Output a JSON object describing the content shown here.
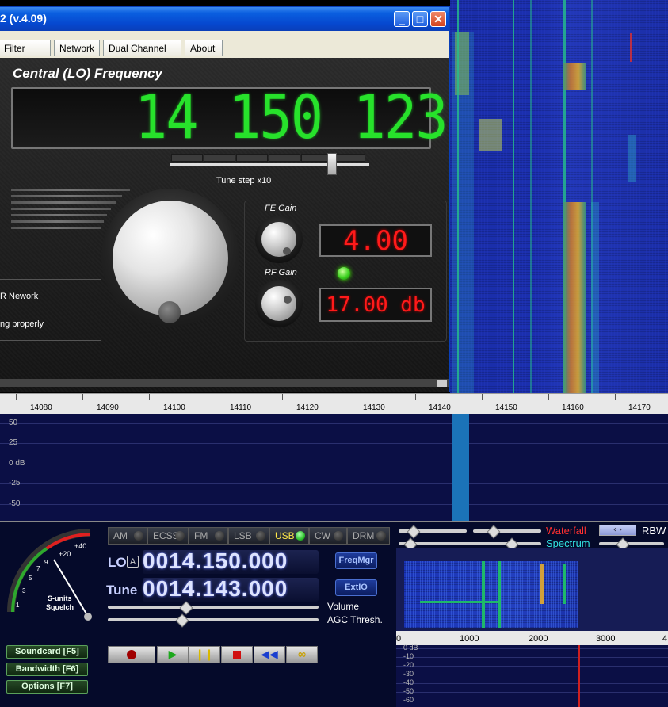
{
  "window": {
    "title": "2 (v.4.09)",
    "minimize_label": "_",
    "maximize_label": "□",
    "close_label": "✕"
  },
  "tabs": [
    "Filter tools",
    "Network",
    "Dual Channel RX",
    "About"
  ],
  "lo_panel": {
    "title": "Central (LO) Frequency",
    "frequency": "14 150 123",
    "tune_step_label": "Tune step x10",
    "fe_gain_label": "FE Gain",
    "rf_gain_label": "RF Gain",
    "fe_gain_value": "4.00",
    "rf_gain_value": "17.00 db",
    "status_line1": "R Nework",
    "status_line2": "ng properly"
  },
  "spectrum": {
    "freq_ticks": [
      "14080",
      "14090",
      "14100",
      "14110",
      "14120",
      "14130",
      "14140",
      "14150",
      "14160",
      "14170"
    ],
    "db_labels": [
      "50",
      "25",
      "0 dB",
      "-25",
      "-50"
    ]
  },
  "controls": {
    "smeter_scale": [
      "1",
      "3",
      "5",
      "7",
      "9",
      "+20",
      "+40"
    ],
    "smeter_label1": "S-units",
    "smeter_label2": "Squelch",
    "modes": [
      "AM",
      "ECSS",
      "FM",
      "LSB",
      "USB",
      "CW",
      "DRM"
    ],
    "active_mode": "USB",
    "lo_label": "LO",
    "lo_badge": "A",
    "lo_freq": "0014.150.000",
    "tune_label": "Tune",
    "tune_freq": "0014.143.000",
    "freqmgr_label": "FreqMgr",
    "extio_label": "ExtIO",
    "volume_label": "Volume",
    "agc_label": "AGC Thresh.",
    "soundcard_label": "Soundcard [F5]",
    "bandwidth_label": "Bandwidth [F6]",
    "options_label": "Options [F7]"
  },
  "right_panel": {
    "waterfall_label": "Waterfall",
    "spectrum_label": "Spectrum",
    "rbw_label": "RBW",
    "rbw_arrows": "‹ ›",
    "mini_ticks": [
      "0",
      "1000",
      "2000",
      "3000",
      "4"
    ],
    "mini_db": [
      "0 dB",
      "-10",
      "-20",
      "-30",
      "-40",
      "-50",
      "-60"
    ]
  },
  "colors": {
    "lo_digits": "#27e22b",
    "gain_digits": "#ff1a1a",
    "waterfall_label": "#ff3030",
    "spectrum_label": "#32e0e0",
    "usb_active": "#ffe84a"
  }
}
